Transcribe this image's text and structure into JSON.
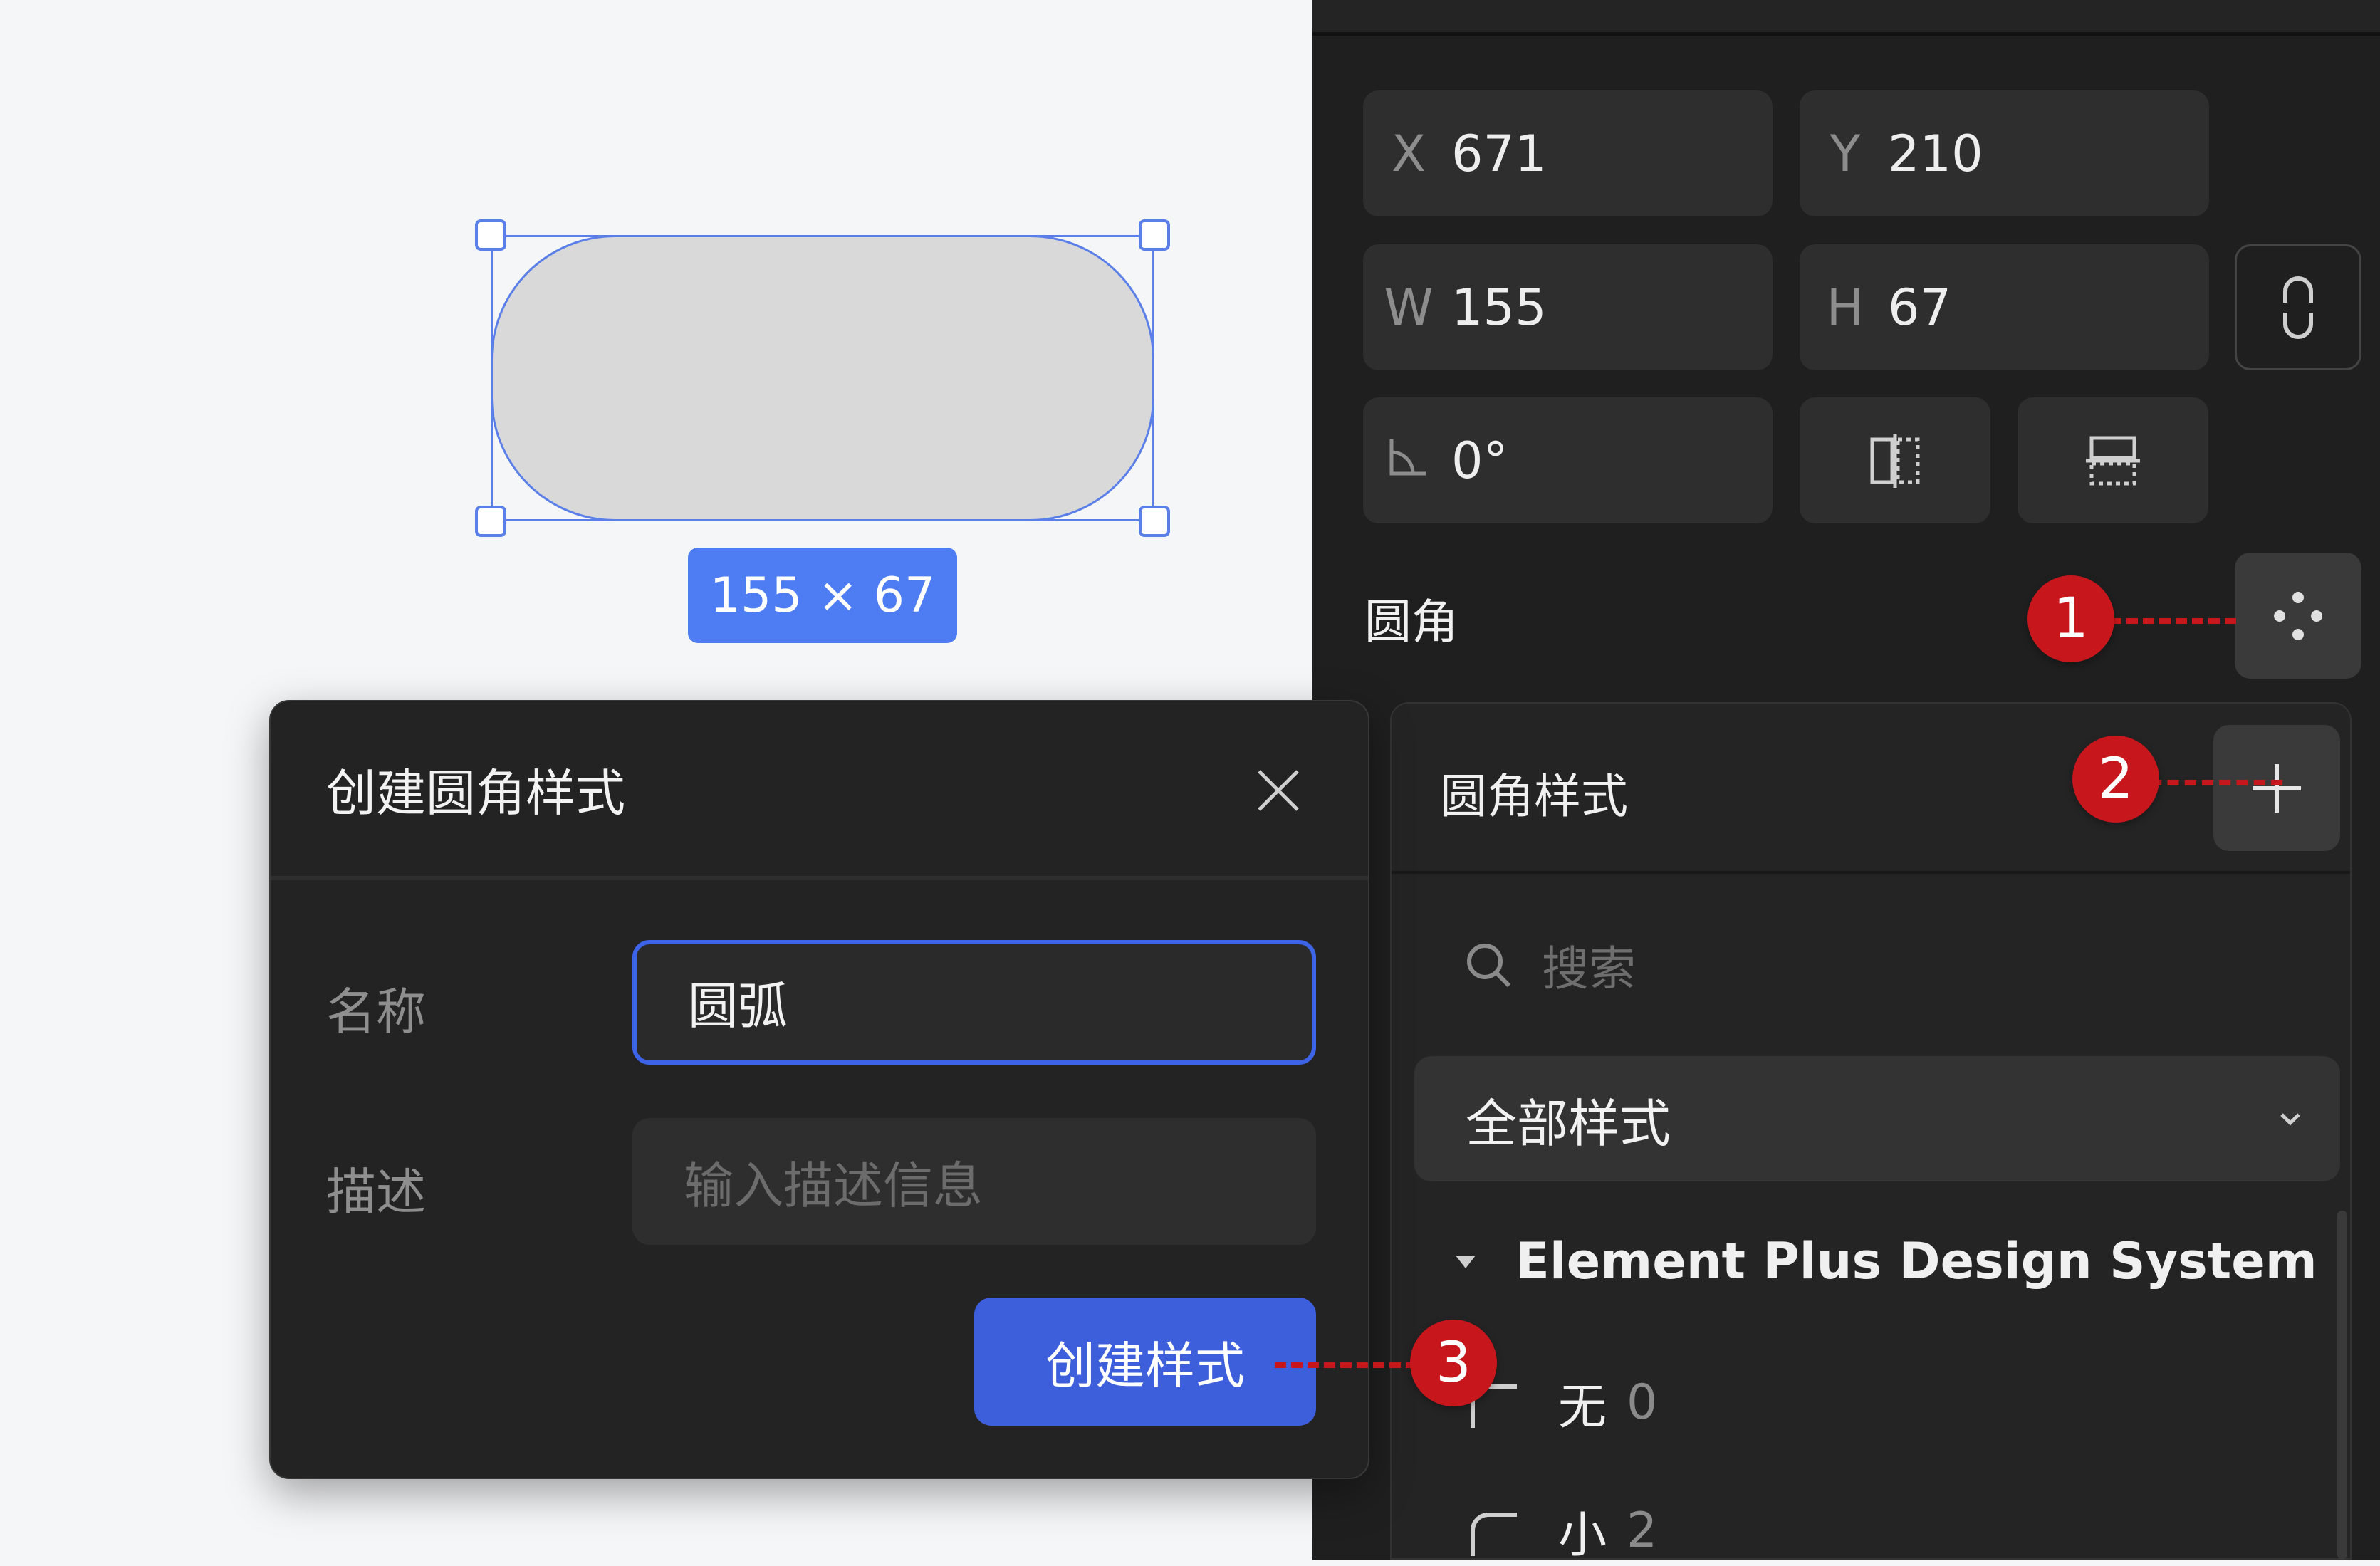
{
  "canvas": {
    "size_badge": "155 × 67"
  },
  "properties": {
    "x_label": "X",
    "x_value": "671",
    "y_label": "Y",
    "y_value": "210",
    "w_label": "W",
    "w_value": "155",
    "h_label": "H",
    "h_value": "67",
    "rotation_value": "0°",
    "corner_title": "圆角"
  },
  "style_panel": {
    "title": "圆角样式",
    "search_placeholder": "搜索",
    "filter_selected": "全部样式",
    "group_name": "Element Plus Design System",
    "items": [
      {
        "name": "无",
        "value": "0"
      },
      {
        "name": "小",
        "value": "2"
      }
    ]
  },
  "dialog": {
    "title": "创建圆角样式",
    "name_label": "名称",
    "name_value": "圆弧",
    "desc_label": "描述",
    "desc_placeholder": "输入描述信息",
    "submit_label": "创建样式"
  },
  "annotations": [
    "1",
    "2",
    "3"
  ],
  "colors": {
    "accent": "#3d5fdb",
    "selection": "#5b7fe8",
    "marker": "#c7161c",
    "panel_bg": "#1f1f1f"
  }
}
